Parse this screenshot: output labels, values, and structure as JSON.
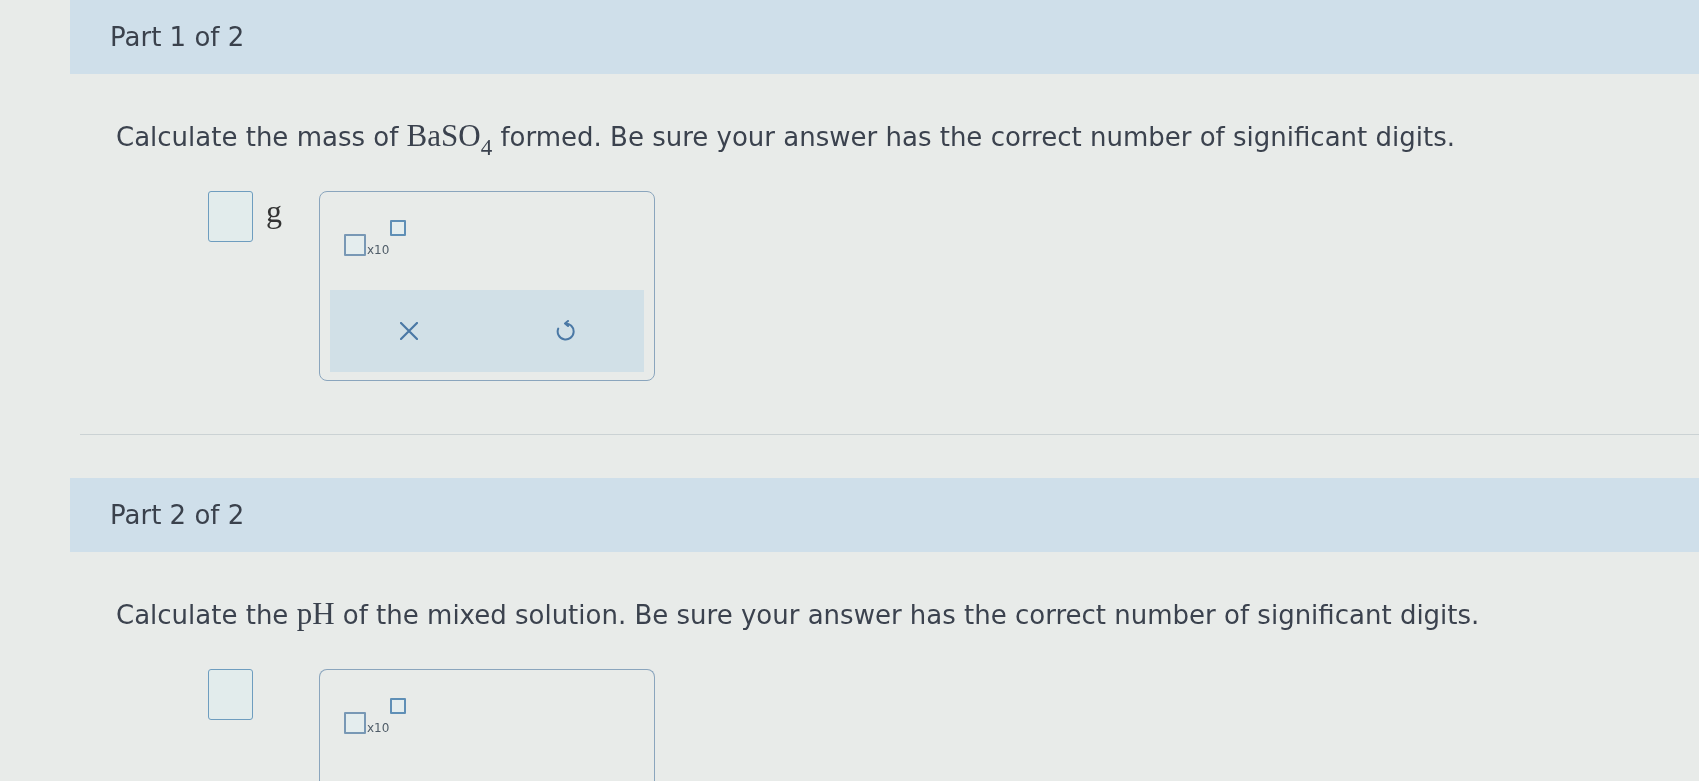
{
  "parts": [
    {
      "heading": "Part 1 of 2",
      "question": [
        {
          "kind": "text",
          "text": "Calculate the mass of "
        },
        {
          "kind": "formula",
          "text": "BaSO$_{4}$"
        },
        {
          "kind": "text",
          "text": " formed. Be sure your answer has the correct number of significant digits."
        }
      ],
      "answer_unit": "g",
      "tool_panel": {
        "template_label": "x10",
        "buttons": [
          {
            "kind": "clear"
          },
          {
            "kind": "undo"
          }
        ]
      }
    },
    {
      "heading": "Part 2 of 2",
      "question": [
        {
          "kind": "text",
          "text": "Calculate the "
        },
        {
          "kind": "formula",
          "text": "pH"
        },
        {
          "kind": "text",
          "text": " of the mixed solution. Be sure your answer has the correct number of significant digits."
        }
      ],
      "tool_panel": {
        "template_label": "x10"
      }
    }
  ]
}
